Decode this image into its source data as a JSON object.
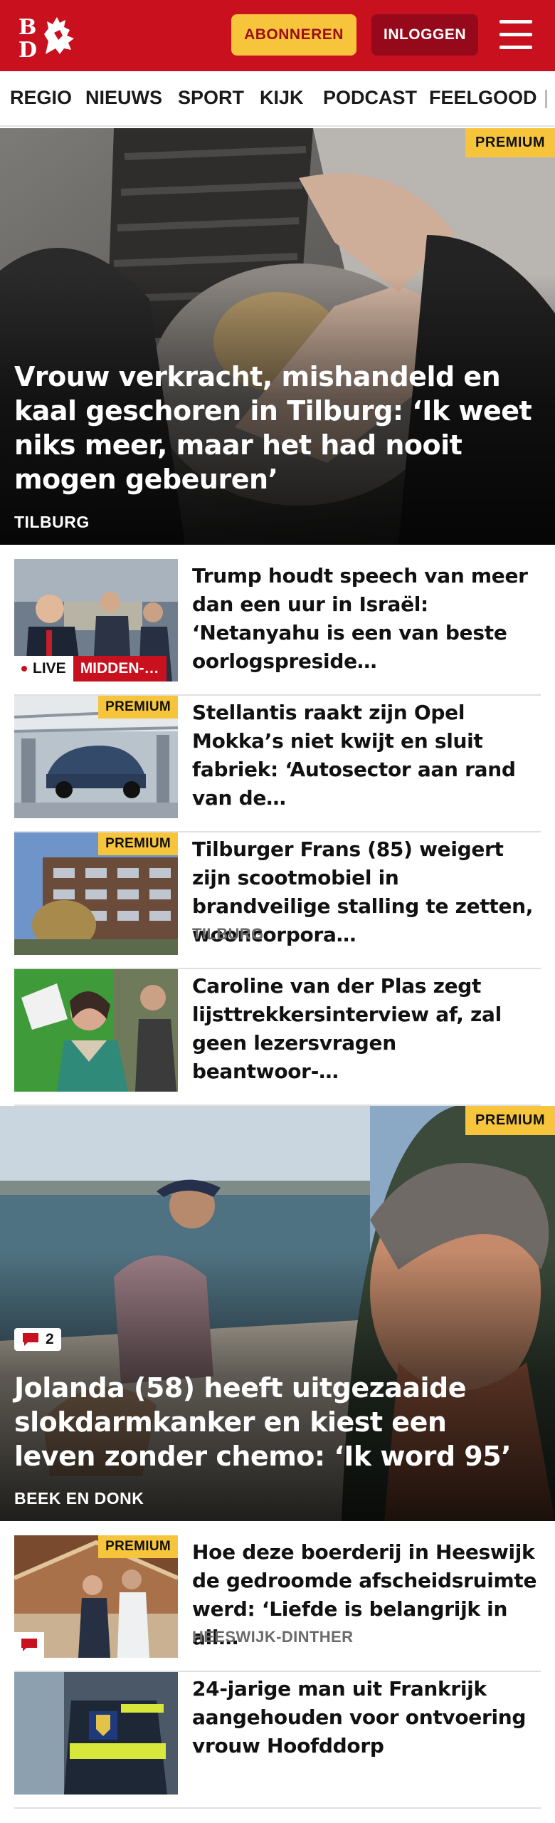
{
  "header": {
    "subscribe_label": "ABONNEREN",
    "login_label": "INLOGGEN",
    "brand_color": "#c8101e",
    "accent_color": "#f7c53c"
  },
  "nav": {
    "items": [
      "REGIO",
      "NIEUWS",
      "SPORT",
      "KIJK",
      "PODCAST",
      "FEELGOOD"
    ]
  },
  "hero1": {
    "badge": "PREMIUM",
    "title": "Vrouw verkracht, mishandeld en kaal geschoren in Tilburg: ‘Ik weet niks meer, maar het had nooit mogen gebeuren’",
    "location": "TILBURG"
  },
  "list1": [
    {
      "title": "Trump houdt speech van meer dan een uur in Israël: ‘Netanyahu is een van beste oorlogspreside…",
      "live_label": "LIVE",
      "topic_label": "MIDDEN-…"
    },
    {
      "badge": "PREMIUM",
      "title": "Stellantis raakt zijn Opel Mokka’s niet kwijt en sluit fabriek: ‘Autosector aan rand van de…"
    },
    {
      "badge": "PREMIUM",
      "title": "Tilburger Frans (85) weigert zijn scootmobiel in brandveilige stalling te zetten, wooncorpora…",
      "location": "TILBURG"
    },
    {
      "title": "Caroline van der Plas zegt lijsttrekkersinterview af, zal geen lezersvragen beantwoor-…"
    }
  ],
  "hero2": {
    "badge": "PREMIUM",
    "comment_count": "2",
    "title": "Jolanda (58) heeft uitgezaaide slokdarmkanker en kiest een leven zonder chemo: ‘Ik word 95’",
    "location": "BEEK EN DONK"
  },
  "list2": [
    {
      "badge": "PREMIUM",
      "title": "Hoe deze boerderij in Heeswijk de gedroomde afscheidsruimte werd: ‘Liefde is belangrijk in all…",
      "location": "HEESWIJK-DINTHER"
    },
    {
      "title": "24-jarige man uit Frankrijk aangehouden voor ontvoering vrouw Hoofddorp"
    }
  ]
}
